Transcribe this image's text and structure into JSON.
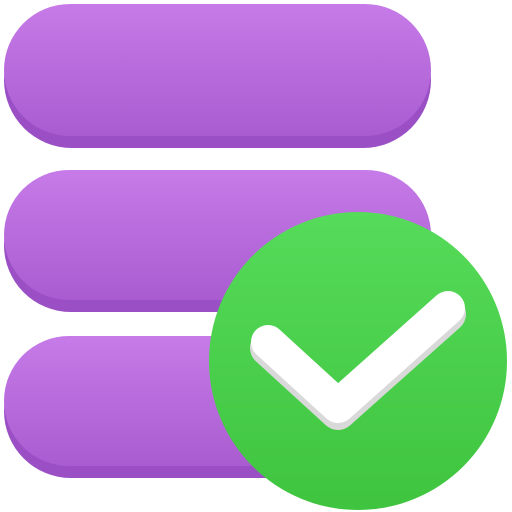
{
  "icon": {
    "name": "database-check-icon",
    "parts": {
      "database": "stacked-database-icon",
      "badge": "check-badge-icon",
      "check": "checkmark-icon"
    },
    "colors": {
      "purple_top": "#C77BE8",
      "purple_bottom": "#A85CD0",
      "purple_shadow": "#9A4FC4",
      "green_top": "#56DB5A",
      "green_bottom": "#3FC43F",
      "check": "#FFFFFF",
      "check_shadow": "#D9D9D9"
    }
  }
}
